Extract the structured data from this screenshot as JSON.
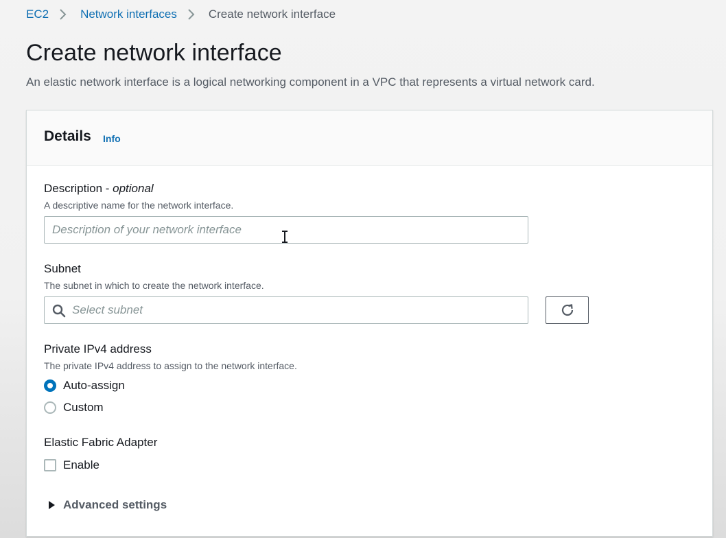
{
  "breadcrumb": {
    "items": [
      "EC2",
      "Network interfaces"
    ],
    "current": "Create network interface"
  },
  "page": {
    "title": "Create network interface",
    "description": "An elastic network interface is a logical networking component in a VPC that represents a virtual network card."
  },
  "details": {
    "title": "Details",
    "info_link": "Info",
    "description_field": {
      "label": "Description - ",
      "label_optional": "optional",
      "hint": "A descriptive name for the network interface.",
      "placeholder": "Description of your network interface",
      "value": ""
    },
    "subnet_field": {
      "label": "Subnet",
      "hint": "The subnet in which to create the network interface.",
      "placeholder": "Select subnet",
      "value": ""
    },
    "ipv4_field": {
      "label": "Private IPv4 address",
      "hint": "The private IPv4 address to assign to the network interface.",
      "options": [
        "Auto-assign",
        "Custom"
      ],
      "selected": "Auto-assign"
    },
    "efa_field": {
      "label": "Elastic Fabric Adapter",
      "checkbox_label": "Enable",
      "checked": false
    },
    "advanced_settings_label": "Advanced settings"
  },
  "icons": {
    "breadcrumb_separator": "chevron-right-icon",
    "subnet_search": "search-icon",
    "refresh": "refresh-icon",
    "advanced_toggle": "caret-right-icon",
    "text_cursor": "text-cursor-icon"
  },
  "colors": {
    "link": "#0f6fb3",
    "radio_selected": "#0073bb",
    "text_primary": "#16191f",
    "text_secondary": "#545b64"
  }
}
